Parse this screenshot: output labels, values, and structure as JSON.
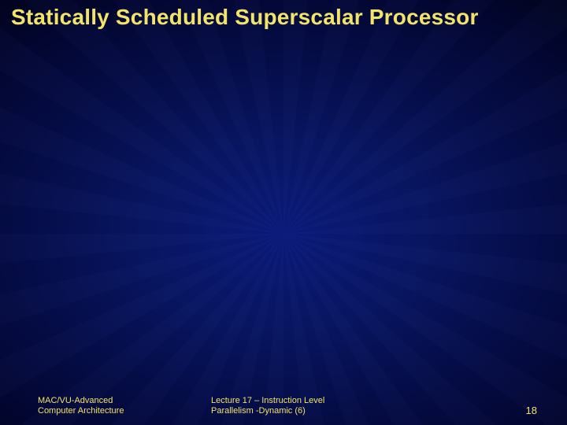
{
  "title": "Statically Scheduled Superscalar Processor",
  "footer": {
    "left_line1": "MAC/VU-Advanced",
    "left_line2": "Computer Architecture",
    "center_line1": "Lecture 17 – Instruction Level",
    "center_line2": "Parallelism -Dynamic (6)",
    "page_number": "18"
  }
}
